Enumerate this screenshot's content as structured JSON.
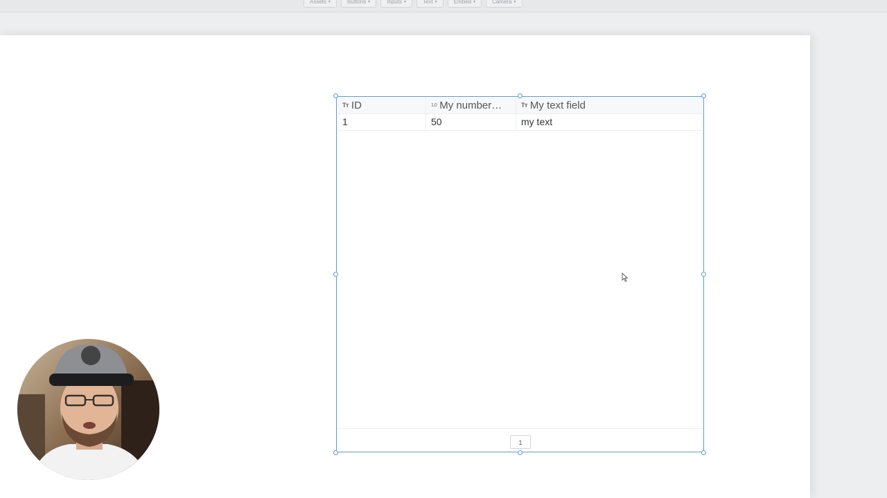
{
  "toolbar": {
    "items": [
      {
        "label": "Assets"
      },
      {
        "label": "Buttons"
      },
      {
        "label": "Inputs"
      },
      {
        "label": "Text"
      },
      {
        "label": "Embed"
      },
      {
        "label": "Camera"
      }
    ]
  },
  "table": {
    "columns": [
      {
        "label": "ID",
        "type_icon": "Tт"
      },
      {
        "label": "My number…",
        "type_icon": "1.0"
      },
      {
        "label": "My text field",
        "type_icon": "Tт"
      }
    ],
    "rows": [
      {
        "id": "1",
        "number": "50",
        "text": "my text"
      }
    ],
    "current_page": "1"
  },
  "colors": {
    "selection": "#5b9bd5",
    "canvas": "#ffffff",
    "background": "#eceef0"
  }
}
